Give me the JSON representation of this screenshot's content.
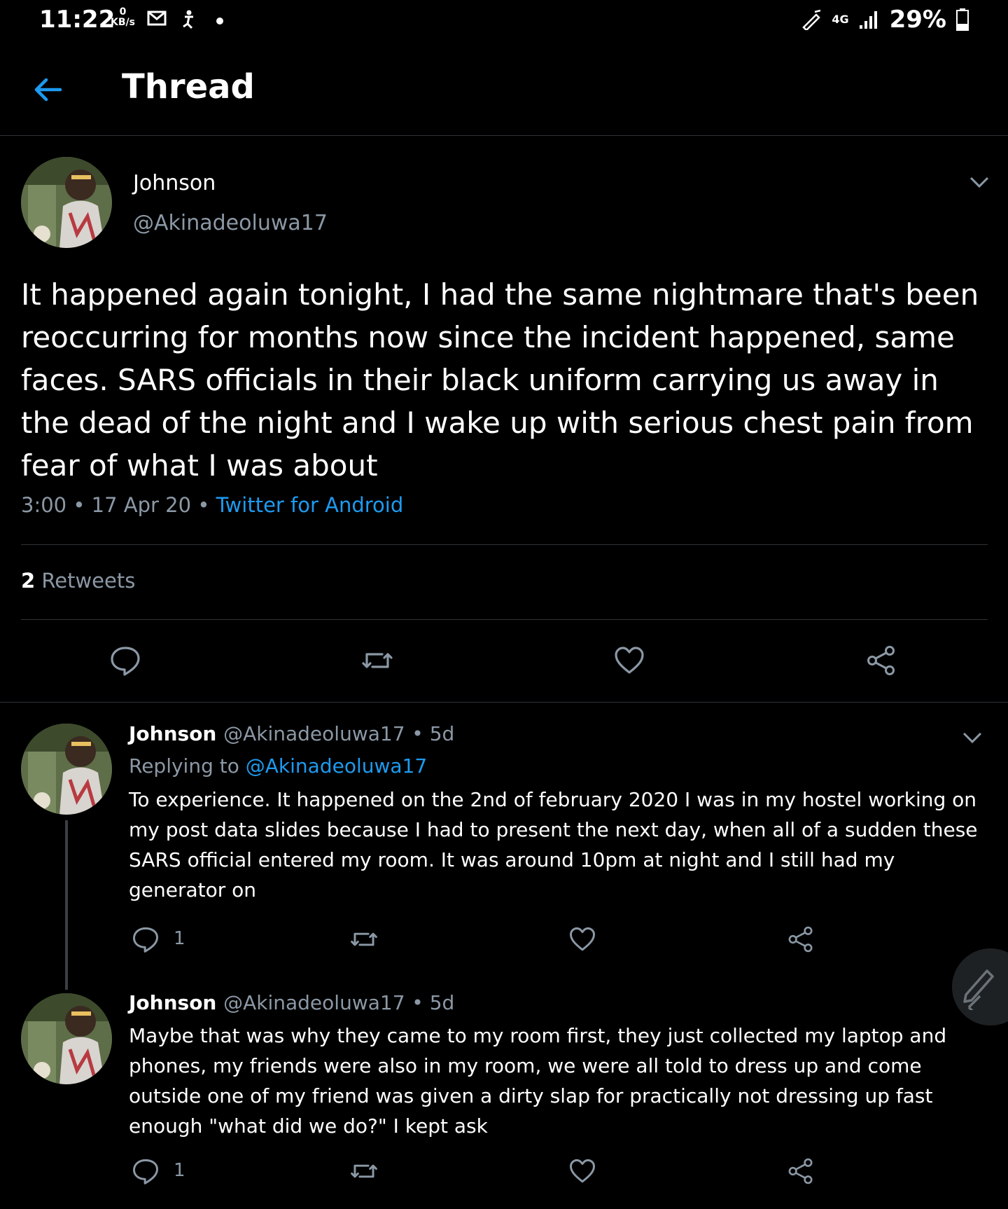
{
  "status_bar": {
    "time": "11:22",
    "speed_value": "0",
    "speed_unit": "KB/s",
    "network": "4G",
    "battery": "29%"
  },
  "header": {
    "title": "Thread"
  },
  "main_tweet": {
    "name": "Johnson",
    "handle": "@Akinadeoluwa17",
    "text": "It happened again tonight, I had the same nightmare that's been reoccurring for months now since the incident happened, same faces. SARS officials in their black uniform carrying us away in the dead of the night and I wake up with serious chest pain from fear of what I was about",
    "time": "3:00",
    "date": "17 Apr 20",
    "source": "Twitter for Android",
    "retweet_count": "2",
    "retweet_label": "Retweets"
  },
  "replies": [
    {
      "name": "Johnson",
      "handle": "@Akinadeoluwa17",
      "age": "5d",
      "replying_prefix": "Replying to",
      "replying_to": "@Akinadeoluwa17",
      "text": "To experience. It happened on the 2nd of february 2020 I was in my hostel working on my post data slides because I had to present the next day, when all of a sudden these SARS official entered my room. It was around 10pm at night and I still had my generator on",
      "reply_count": "1"
    },
    {
      "name": "Johnson",
      "handle": "@Akinadeoluwa17",
      "age": "5d",
      "text": "Maybe that was why they came to my room first, they just collected my laptop and phones, my friends were also in my room, we were all told to dress up and come outside one of my friend was given a dirty slap for practically not dressing up fast enough \"what did we do?\" I kept ask",
      "reply_count": "1"
    }
  ],
  "colors": {
    "accent": "#1d9bf0",
    "muted": "#8b98a5",
    "background": "#000000",
    "divider": "#2f3336"
  }
}
